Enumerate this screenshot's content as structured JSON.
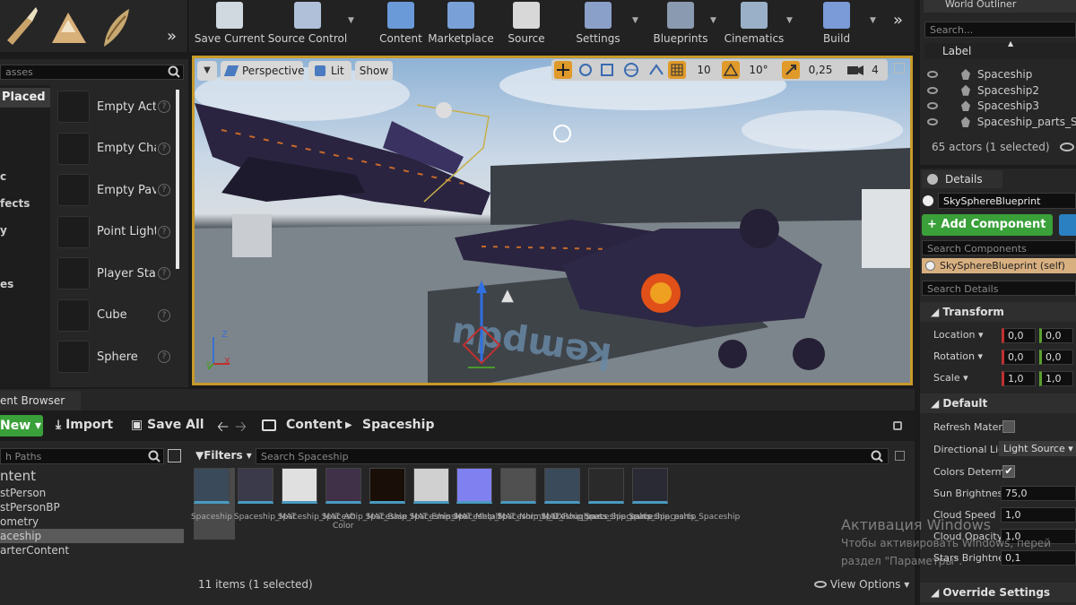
{
  "toolbar": {
    "buttons": [
      {
        "label": "Save Current",
        "icon": "save-icon"
      },
      {
        "label": "Source Control",
        "icon": "source-control-icon"
      },
      {
        "label": "Content",
        "icon": "content-icon"
      },
      {
        "label": "Marketplace",
        "icon": "marketplace-icon"
      },
      {
        "label": "Source",
        "icon": "source-icon"
      },
      {
        "label": "Settings",
        "icon": "settings-icon"
      },
      {
        "label": "Blueprints",
        "icon": "blueprints-icon"
      },
      {
        "label": "Cinematics",
        "icon": "cinematics-icon"
      },
      {
        "label": "Build",
        "icon": "build-icon"
      }
    ],
    "overflow": "»"
  },
  "modes": {
    "search_placeholder": "asses",
    "categories": [
      {
        "label": "Placed",
        "active": true
      },
      {
        "label": "c"
      },
      {
        "label": "fects"
      },
      {
        "label": "y"
      },
      {
        "label": "es"
      }
    ],
    "items": [
      {
        "label": "Empty Acto",
        "icon": "sphere-icon"
      },
      {
        "label": "Empty Cha",
        "icon": "character-icon"
      },
      {
        "label": "Empty Pav",
        "icon": "pawn-icon"
      },
      {
        "label": "Point Light",
        "icon": "point-light-icon"
      },
      {
        "label": "Player Sta",
        "icon": "player-start-icon"
      },
      {
        "label": "Cube",
        "icon": "cube-icon"
      },
      {
        "label": "Sphere",
        "icon": "sphere-icon"
      }
    ]
  },
  "viewport": {
    "perspective": "Perspective",
    "lit": "Lit",
    "show": "Show",
    "grid_snap": "10",
    "rot_snap": "10°",
    "scale_snap": "0,25",
    "cam_speed": "4",
    "axis_z": "Z",
    "axis_x": "X",
    "axis_y": "Y"
  },
  "outliner": {
    "title": "World Outliner",
    "search_placeholder": "Search...",
    "label_header": "Label",
    "rows": [
      "Spaceship",
      "Spaceship2",
      "Spaceship3",
      "Spaceship_parts_S"
    ],
    "status": "65 actors (1 selected)"
  },
  "details": {
    "tab": "Details",
    "object_name": "SkySphereBlueprint",
    "add_component": "+ Add Component",
    "search_components_placeholder": "Search Components",
    "self_component": "SkySphereBlueprint (self)",
    "search_details_placeholder": "Search Details",
    "transform": {
      "title": "Transform",
      "location": {
        "label": "Location",
        "x": "0,0",
        "y": "0,0"
      },
      "rotation": {
        "label": "Rotation",
        "x": "0,0",
        "y": "0,0"
      },
      "scale": {
        "label": "Scale",
        "x": "1,0",
        "y": "1,0"
      }
    },
    "default": {
      "title": "Default",
      "refresh_material": "Refresh Mater",
      "directional_light": "Directional Lig",
      "directional_light_value": "Light Source",
      "colors_determined": "Colors Determ",
      "sun_brightness": "Sun Brightnes",
      "sun_brightness_value": "75,0",
      "cloud_speed": "Cloud Speed",
      "cloud_speed_value": "1,0",
      "cloud_opacity": "Cloud Opacity",
      "cloud_opacity_value": "1,0",
      "stars_brightness": "Stars Brightne",
      "stars_brightness_value": "0,1"
    },
    "override_settings": "Override Settings"
  },
  "content_browser": {
    "tab": "ent Browser",
    "new_label": "New",
    "import_label": "Import",
    "save_all_label": "Save All",
    "path_root": "Content",
    "path_leaf": "Spaceship",
    "search_paths_placeholder": "h Paths",
    "filters_label": "Filters",
    "search_assets_placeholder": "Search Spaceship",
    "tree": [
      "ntent",
      "stPerson",
      "stPersonBP",
      "ometry",
      "aceship",
      "arterContent"
    ],
    "assets": [
      {
        "name": "Spaceship",
        "color": "#3a4a5a"
      },
      {
        "name": "Spaceship_MAT",
        "color": "#3a3a4a"
      },
      {
        "name": "Spaceship_MAT_AO",
        "color": "#e0e0e0"
      },
      {
        "name": "Spaceship_MAT_Base Color",
        "color": "#403048"
      },
      {
        "name": "Spaceship_MAT_Emissive",
        "color": "#1a0e08"
      },
      {
        "name": "Spaceship_MAT_Metallic",
        "color": "#d0d0d0"
      },
      {
        "name": "Spaceship_MAT_Normal_DX",
        "color": "#8080f0"
      },
      {
        "name": "Spaceship_MAT_Roughness",
        "color": "#505050"
      },
      {
        "name": "Spaceship_parts_Spaceship",
        "color": "#3a4a5a"
      },
      {
        "name": "Spaceship_parts_Spaceship",
        "color": "#2a2a2a"
      },
      {
        "name": "Spaceship_parts_Spaceship",
        "color": "#2a2a34"
      }
    ],
    "status": "11 items (1 selected)",
    "view_options": "View Options"
  },
  "watermark": {
    "line1": "Активация Windows",
    "line2": "Чтобы активировать Windows, перей",
    "line3": "раздел \"Параметры\"."
  }
}
